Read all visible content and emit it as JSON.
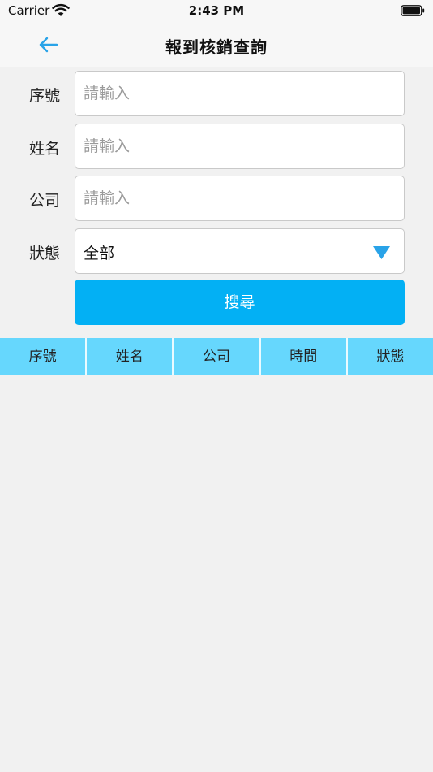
{
  "status_bar": {
    "carrier": "Carrier",
    "time": "2:43 PM"
  },
  "nav": {
    "title": "報到核銷查詢"
  },
  "form": {
    "serial": {
      "label": "序號",
      "placeholder": "請輸入"
    },
    "name": {
      "label": "姓名",
      "placeholder": "請輸入"
    },
    "company": {
      "label": "公司",
      "placeholder": "請輸入"
    },
    "status": {
      "label": "狀態",
      "value": "全部"
    },
    "search_label": "搜尋"
  },
  "table": {
    "columns": [
      "序號",
      "姓名",
      "公司",
      "時間",
      "狀態"
    ]
  },
  "colors": {
    "accent": "#03b0f4",
    "header": "#66d7fd",
    "back_arrow": "#29a3e8"
  }
}
